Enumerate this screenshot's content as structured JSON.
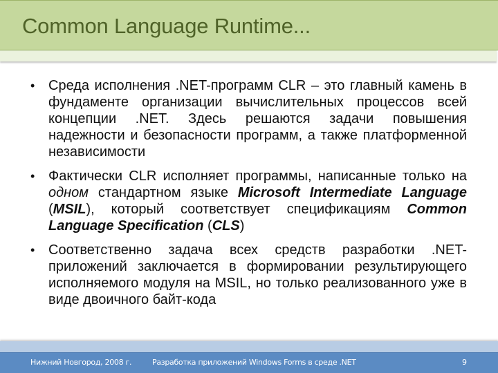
{
  "slide": {
    "title": "Common Language Runtime...",
    "colors": {
      "header_band": "#c5d89d",
      "title_text": "#4f6228",
      "footer_band": "#5b8bc3",
      "footer_light": "#b8cce4"
    },
    "bullets": [
      {
        "segments": [
          {
            "text": "Среда исполнения .NET-программ CLR – это главный камень в фундаменте организации вычислительных процессов всей концепции .NET. Здесь решаются задачи повышения надежности и безопасности программ, а также платформенной независимости",
            "style": "normal"
          }
        ]
      },
      {
        "segments": [
          {
            "text": "Фактически CLR исполняет программы, написанные только на ",
            "style": "normal"
          },
          {
            "text": "одном",
            "style": "italic"
          },
          {
            "text": " стандартном языке ",
            "style": "normal"
          },
          {
            "text": "Microsoft Intermediate Language",
            "style": "bold-italic"
          },
          {
            "text": " (",
            "style": "normal"
          },
          {
            "text": "MSIL",
            "style": "bold-italic"
          },
          {
            "text": "), который соответствует спецификациям ",
            "style": "normal"
          },
          {
            "text": "Common Language Specification",
            "style": "bold-italic"
          },
          {
            "text": " (",
            "style": "normal"
          },
          {
            "text": "CLS",
            "style": "bold-italic"
          },
          {
            "text": ")",
            "style": "normal"
          }
        ]
      },
      {
        "segments": [
          {
            "text": "Соответственно задача всех средств разработки .NET-приложений заключается в формировании результирующего исполняемого модуля на MSIL, но только реализованного уже в виде двоичного байт-кода",
            "style": "normal"
          }
        ]
      }
    ],
    "bullet_glyph": "•"
  },
  "footer": {
    "left": "Нижний Новгород, 2008 г.",
    "center": "Разработка приложений Windows Forms в среде .NET",
    "page_number": "9"
  }
}
